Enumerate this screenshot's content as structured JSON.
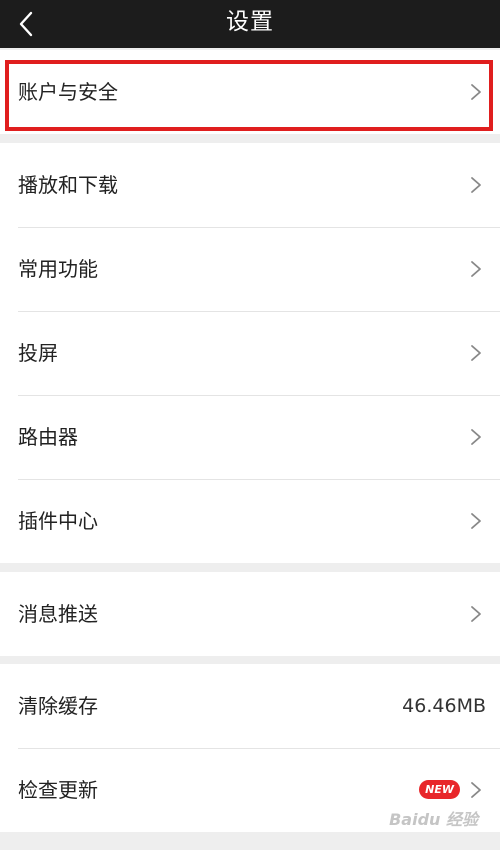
{
  "header": {
    "title": "设置",
    "back_icon": "chevron-left-icon"
  },
  "groups": {
    "account": {
      "label": "账户与安全"
    },
    "play_download": {
      "label": "播放和下载"
    },
    "common_features": {
      "label": "常用功能"
    },
    "screen_cast": {
      "label": "投屏"
    },
    "router": {
      "label": "路由器"
    },
    "plugin_center": {
      "label": "插件中心"
    },
    "push": {
      "label": "消息推送"
    },
    "clear_cache": {
      "label": "清除缓存",
      "value": "46.46MB"
    },
    "check_update": {
      "label": "检查更新",
      "badge": "NEW"
    }
  },
  "watermark": "Baidu 经验",
  "colors": {
    "topbar": "#1c1c1c",
    "background": "#eeeeee",
    "highlight": "#e01e1e",
    "badge": "#e8262a"
  }
}
